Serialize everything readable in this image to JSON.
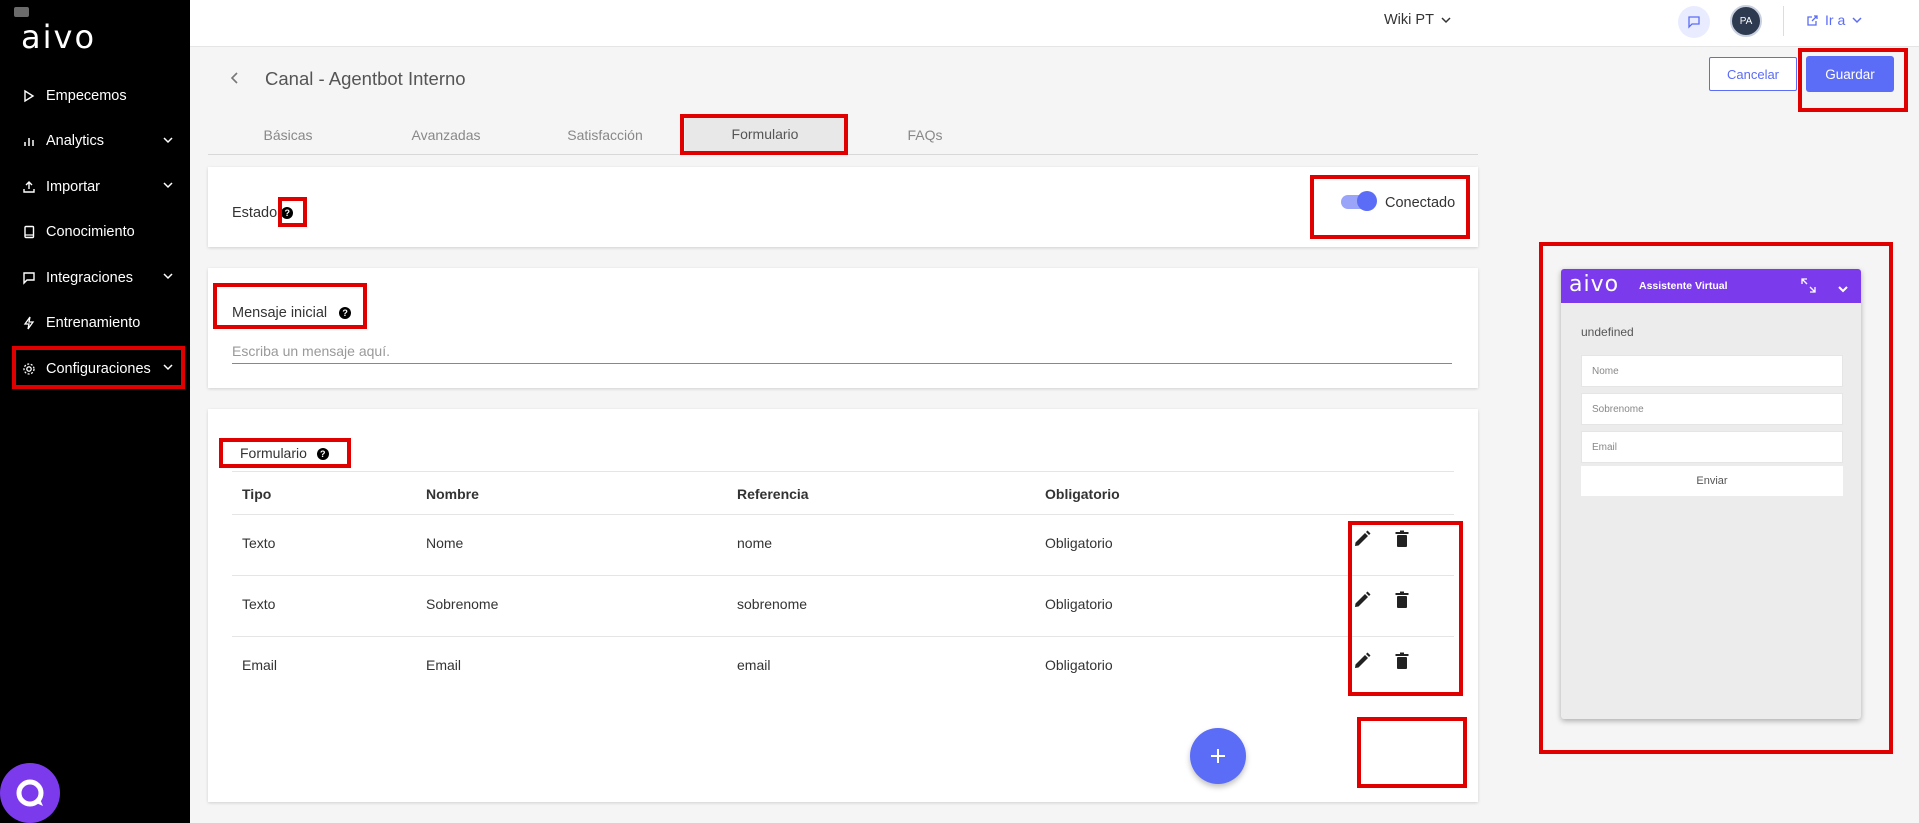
{
  "sidebar": {
    "logo": "aivo",
    "items": [
      {
        "label": "Empecemos",
        "icon": "play-icon",
        "expandable": false
      },
      {
        "label": "Analytics",
        "icon": "bar-chart-icon",
        "expandable": true
      },
      {
        "label": "Importar",
        "icon": "upload-icon",
        "expandable": true
      },
      {
        "label": "Conocimiento",
        "icon": "book-icon",
        "expandable": false
      },
      {
        "label": "Integraciones",
        "icon": "message-icon",
        "expandable": true
      },
      {
        "label": "Entrenamiento",
        "icon": "bolt-icon",
        "expandable": false
      },
      {
        "label": "Configuraciones",
        "icon": "gear-icon",
        "expandable": true
      }
    ]
  },
  "topbar": {
    "wiki_label": "Wiki PT",
    "avatar_initials": "PA",
    "goto_label": "Ir a"
  },
  "header": {
    "title": "Canal - Agentbot Interno",
    "cancel_label": "Cancelar",
    "save_label": "Guardar"
  },
  "tabs": [
    {
      "label": "Básicas",
      "active": false
    },
    {
      "label": "Avanzadas",
      "active": false
    },
    {
      "label": "Satisfacción",
      "active": false
    },
    {
      "label": "Formulario",
      "active": true
    },
    {
      "label": "FAQs",
      "active": false
    }
  ],
  "estado": {
    "label": "Estado",
    "toggle_label": "Conectado",
    "toggle_on": true
  },
  "mensaje": {
    "label": "Mensaje inicial",
    "placeholder": "Escriba un mensaje aquí."
  },
  "formulario": {
    "label": "Formulario",
    "columns": [
      "Tipo",
      "Nombre",
      "Referencia",
      "Obligatorio"
    ],
    "rows": [
      {
        "tipo": "Texto",
        "nombre": "Nome",
        "referencia": "nome",
        "obligatorio": "Obligatorio"
      },
      {
        "tipo": "Texto",
        "nombre": "Sobrenome",
        "referencia": "sobrenome",
        "obligatorio": "Obligatorio"
      },
      {
        "tipo": "Email",
        "nombre": "Email",
        "referencia": "email",
        "obligatorio": "Obligatorio"
      }
    ]
  },
  "preview": {
    "logo": "aivo",
    "title": "Assistente Virtual",
    "message": "undefined",
    "fields": [
      "Nome",
      "Sobrenome",
      "Email"
    ],
    "send_label": "Enviar"
  },
  "colors": {
    "accent": "#5b6cf6",
    "widget_header": "#7c3aed",
    "sidebar_bg": "#000000",
    "highlight": "#e00000"
  }
}
